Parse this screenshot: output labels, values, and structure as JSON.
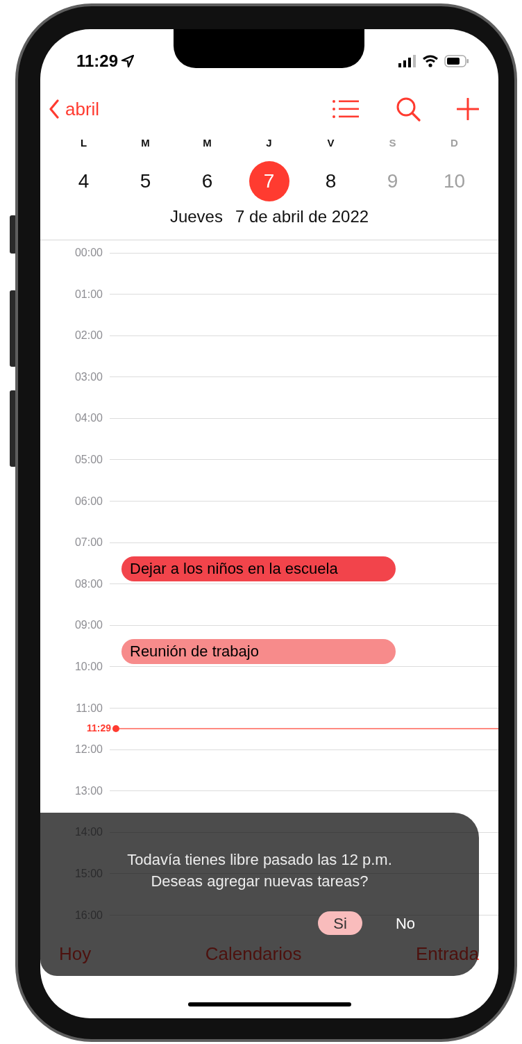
{
  "status_bar": {
    "time": "11:29"
  },
  "nav": {
    "back": "abril"
  },
  "week": [
    {
      "letter": "L",
      "number": "4",
      "selected": false,
      "weekend": false
    },
    {
      "letter": "M",
      "number": "5",
      "selected": false,
      "weekend": false
    },
    {
      "letter": "M",
      "number": "6",
      "selected": false,
      "weekend": false
    },
    {
      "letter": "J",
      "number": "7",
      "selected": true,
      "weekend": false
    },
    {
      "letter": "V",
      "number": "8",
      "selected": false,
      "weekend": false
    },
    {
      "letter": "S",
      "number": "9",
      "selected": false,
      "weekend": true
    },
    {
      "letter": "D",
      "number": "10",
      "selected": false,
      "weekend": true
    }
  ],
  "date_title": {
    "weekday": "Jueves",
    "date": "7 de abril de 2022"
  },
  "hours": [
    {
      "label": "00:00"
    },
    {
      "label": "01:00"
    },
    {
      "label": "02:00"
    },
    {
      "label": "03:00"
    },
    {
      "label": "04:00"
    },
    {
      "label": "05:00"
    },
    {
      "label": "06:00"
    },
    {
      "label": "07:00",
      "events": [
        {
          "title": "Dejar a los niños en la escuela",
          "color": "#f2444b"
        }
      ]
    },
    {
      "label": "08:00"
    },
    {
      "label": "09:00",
      "events": [
        {
          "title": "Reunión de trabajo",
          "color": "#f78b8b"
        }
      ]
    },
    {
      "label": "10:00"
    },
    {
      "label": "11:00",
      "now": "11:29"
    },
    {
      "label": "12:00"
    },
    {
      "label": "13:00"
    },
    {
      "label": "14:00"
    },
    {
      "label": "15:00"
    },
    {
      "label": "16:00"
    }
  ],
  "toolbar": [
    "Hoy",
    "Calendarios",
    "Entrada"
  ],
  "prompt": {
    "lines": [
      "Todavía tienes libre pasado las 12 p.m.",
      "Deseas agregar nuevas tareas?"
    ],
    "buttons": [
      {
        "label": "Si",
        "selected": true
      },
      {
        "label": "No",
        "selected": false
      }
    ]
  }
}
